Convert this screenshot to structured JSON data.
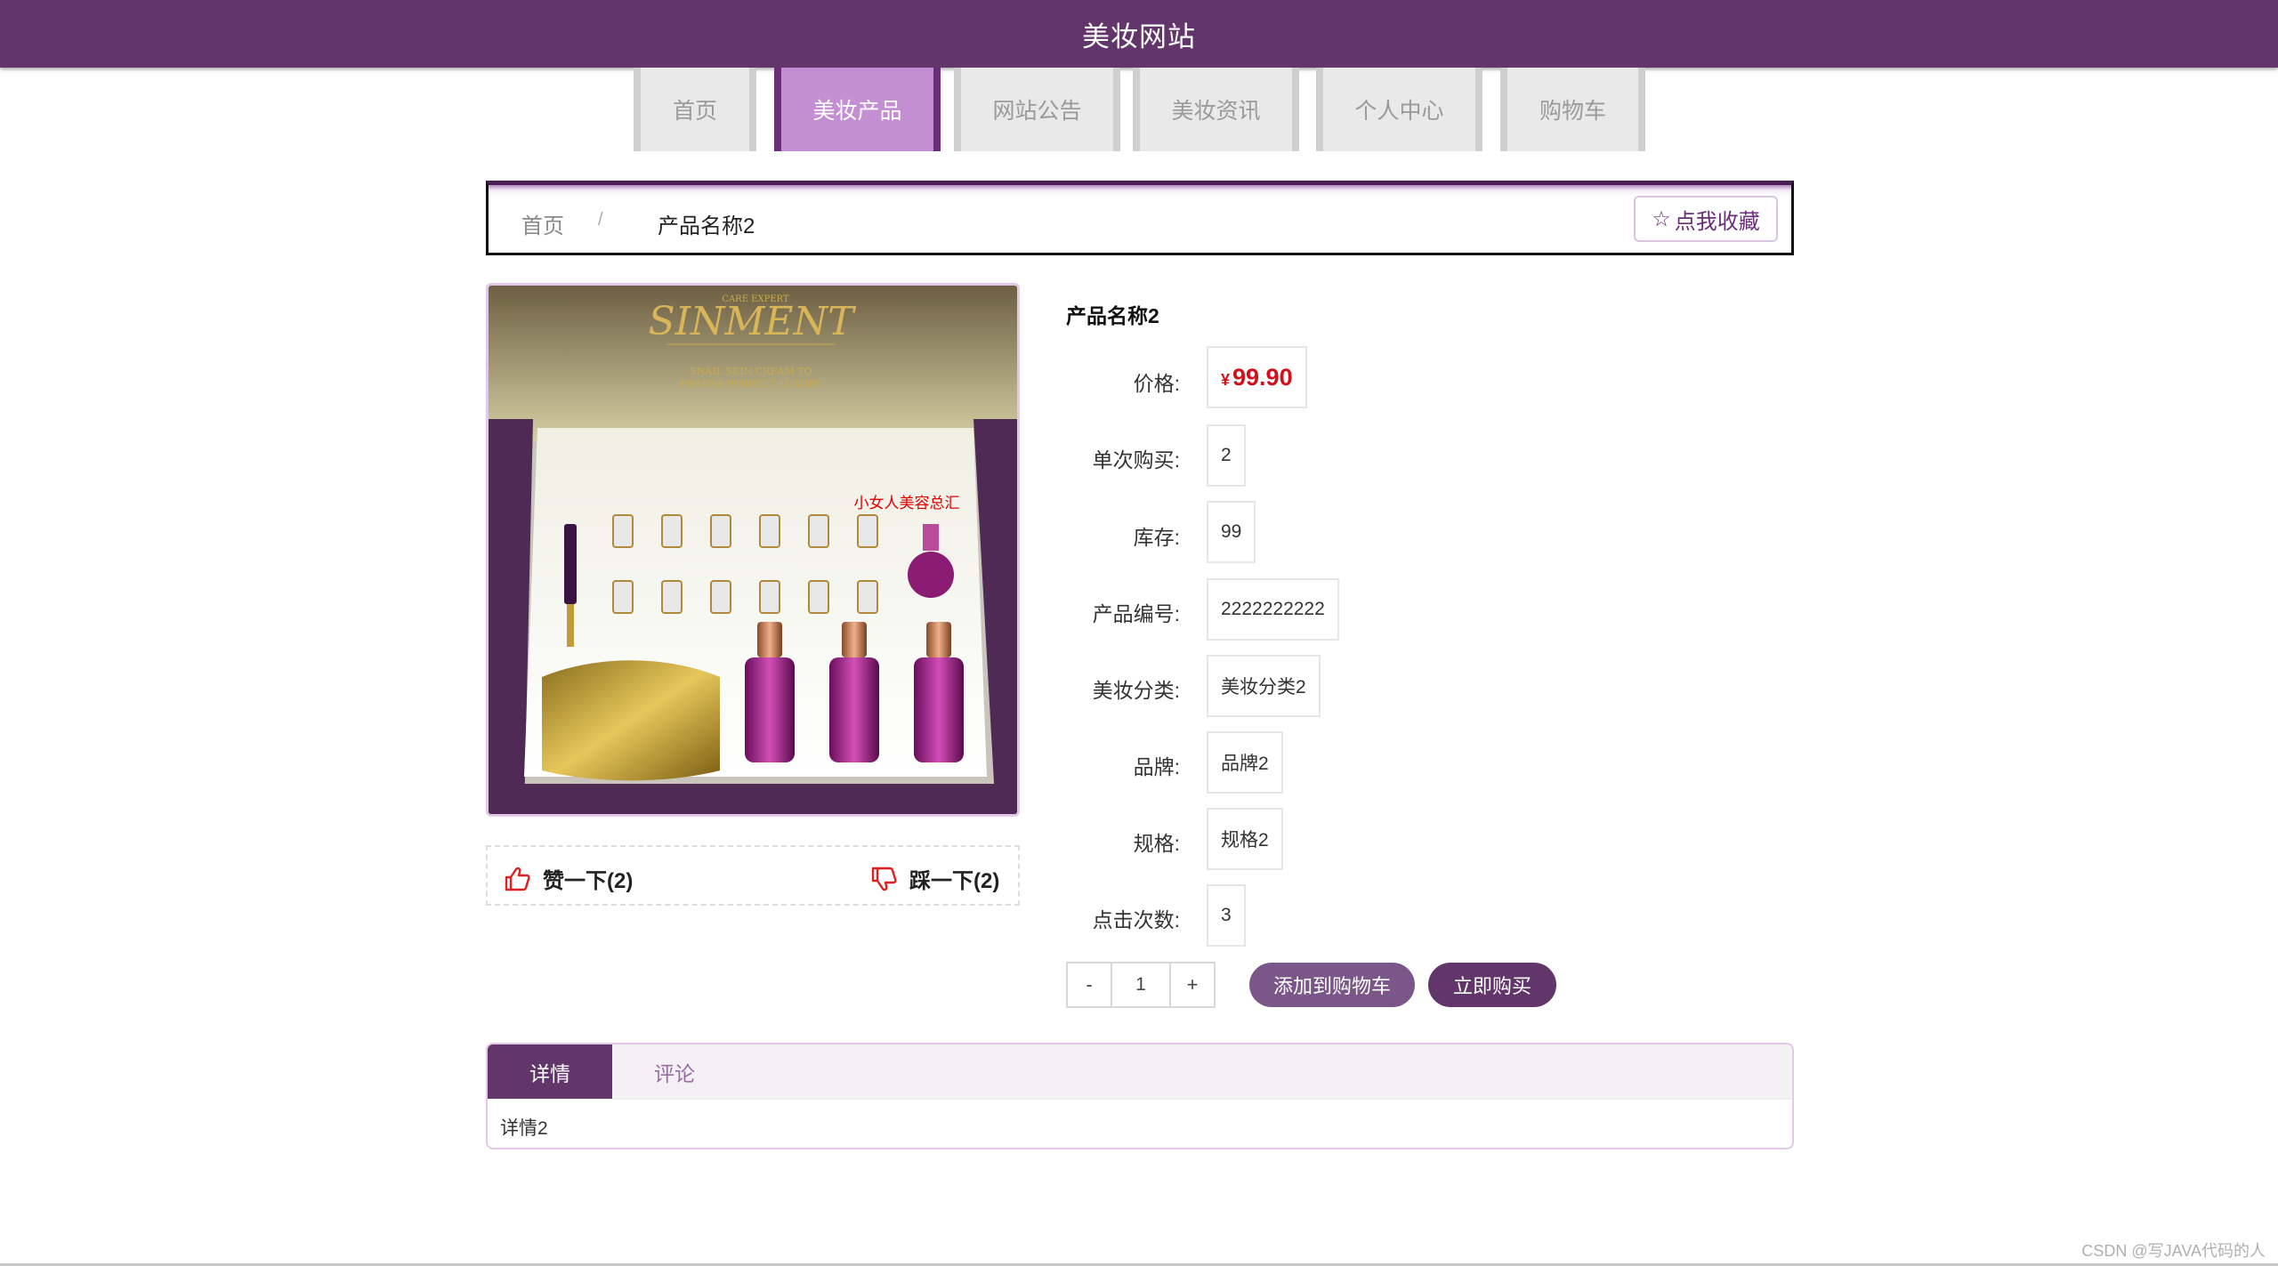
{
  "site_title": "美妆网站",
  "nav": {
    "items": [
      {
        "label": "首页"
      },
      {
        "label": "美妆产品",
        "active": true
      },
      {
        "label": "网站公告"
      },
      {
        "label": "美妆资讯"
      },
      {
        "label": "个人中心"
      },
      {
        "label": "购物车"
      }
    ]
  },
  "breadcrumb": {
    "home": "首页",
    "separator": "/",
    "current": "产品名称2",
    "favorite_label": "点我收藏",
    "favorite_icon": "star-outline-icon"
  },
  "product": {
    "image_label": "小女人美容总汇",
    "like_label": "赞一下(2)",
    "dislike_label": "踩一下(2)",
    "title": "产品名称2",
    "price_currency": "¥",
    "price": "99.90",
    "fields": [
      {
        "label": "价格:",
        "value": ""
      },
      {
        "label": "单次购买:",
        "value": "2"
      },
      {
        "label": "库存:",
        "value": "99"
      },
      {
        "label": "产品编号:",
        "value": "2222222222"
      },
      {
        "label": "美妆分类:",
        "value": "美妆分类2"
      },
      {
        "label": "品牌:",
        "value": "品牌2"
      },
      {
        "label": "规格:",
        "value": "规格2"
      },
      {
        "label": "点击次数:",
        "value": "3"
      }
    ],
    "quantity": {
      "minus": "-",
      "value": "1",
      "plus": "+"
    },
    "add_to_cart": "添加到购物车",
    "buy_now": "立即购买"
  },
  "tabs": {
    "items": [
      {
        "label": "详情"
      },
      {
        "label": "评论"
      }
    ],
    "content": "详情2"
  },
  "watermark": "CSDN @写JAVA代码的人",
  "colors": {
    "brand": "#62356b",
    "nav_active": "#c48ed3",
    "price": "#d0111b",
    "cart_button": "#7a5788"
  }
}
